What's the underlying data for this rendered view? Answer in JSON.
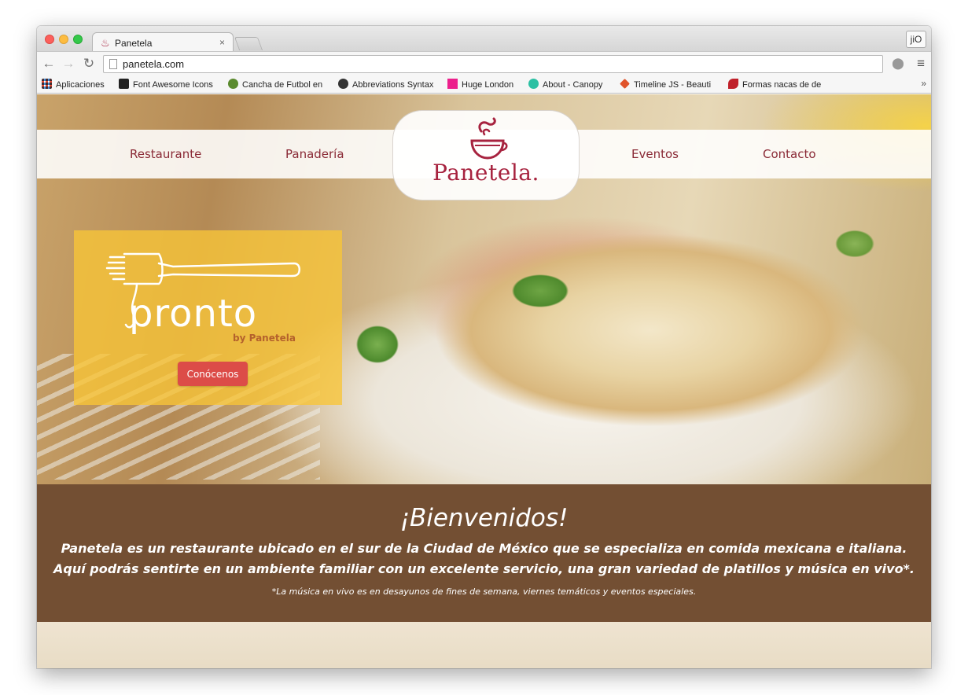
{
  "browser": {
    "tab_title": "Panetela",
    "tab_close": "×",
    "profile": "jiO",
    "url": "panetela.com",
    "bookmarks": [
      {
        "label": "Aplicaciones",
        "color": "#e44d3a"
      },
      {
        "label": "Font Awesome Icons",
        "color": "#222222"
      },
      {
        "label": "Cancha de Futbol en",
        "color": "#5a8a2e"
      },
      {
        "label": "Abbreviations Syntax",
        "color": "#333333"
      },
      {
        "label": "Huge London",
        "color": "#ec1f8c"
      },
      {
        "label": "About - Canopy",
        "color": "#2bc0a3"
      },
      {
        "label": "Timeline JS - Beauti",
        "color": "#e0532a"
      },
      {
        "label": "Formas nacas de de",
        "color": "#c0202a"
      }
    ],
    "more": "»"
  },
  "site": {
    "nav": {
      "restaurante": "Restaurante",
      "panaderia": "Panadería",
      "eventos": "Eventos",
      "contacto": "Contacto"
    },
    "logo_text": "Panetela.",
    "promo": {
      "title": "pronto",
      "byline": "by Panetela",
      "button": "Conócenos"
    },
    "welcome": {
      "heading": "¡Bienvenidos!",
      "line1": "Panetela es un restaurante ubicado en el sur de la Ciudad de México que se especializa en comida mexicana e italiana.",
      "line2": "Aquí podrás sentirte en un ambiente familiar con un excelente servicio, una gran variedad de platillos y música en vivo*.",
      "note": "*La música en vivo es en desayunos de fines de semana, viernes temáticos y eventos especiales."
    }
  },
  "colors": {
    "brand": "#a7233f",
    "promo_bg": "#f9c537",
    "cta": "#dc4c48",
    "welcome_bg": "#734f33"
  }
}
